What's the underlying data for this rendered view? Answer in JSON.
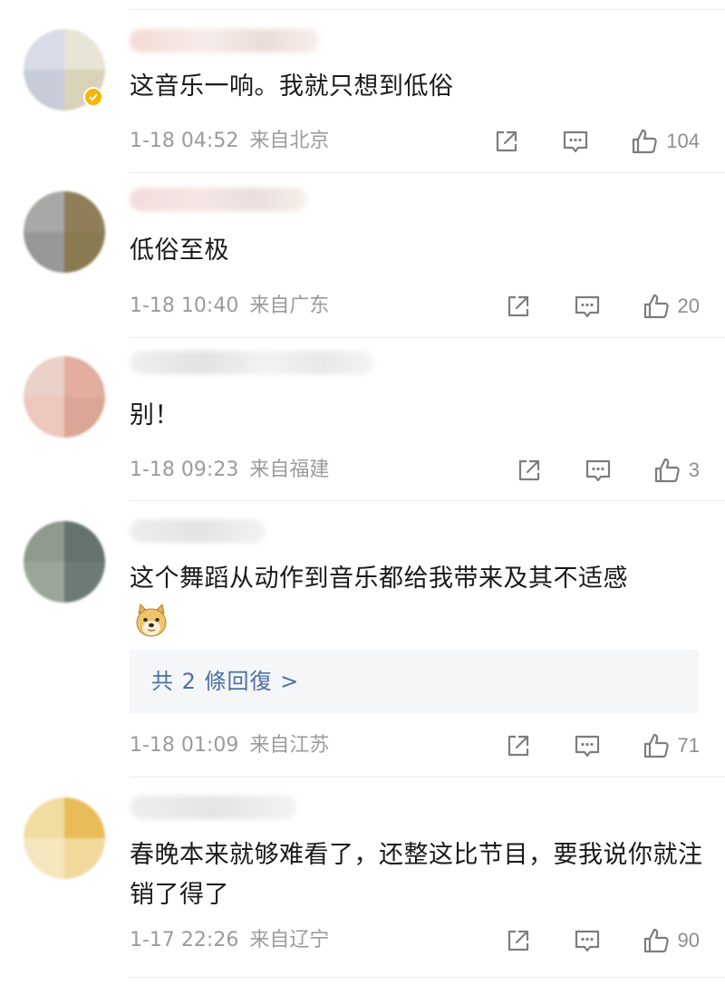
{
  "comments": [
    {
      "text": "这音乐一响。我就只想到低俗",
      "time": "1-18 04:52",
      "location": "来自北京",
      "likes": "104",
      "verified": true,
      "avatar_colors": [
        "#d9dce6",
        "#e8e4d6",
        "#c8ccd8",
        "#d9d2b8"
      ]
    },
    {
      "text": "低俗至极",
      "time": "1-18 10:40",
      "location": "来自广东",
      "likes": "20",
      "avatar_colors": [
        "#a9a8a6",
        "#8f7e58",
        "#9a9896",
        "#8a7a52"
      ]
    },
    {
      "text": "别！",
      "time": "1-18 09:23",
      "location": "来自福建",
      "likes": "3",
      "avatar_colors": [
        "#ead1c8",
        "#e3aea0",
        "#eec7bc",
        "#dba595"
      ]
    },
    {
      "text": "这个舞蹈从动作到音乐都给我带来及其不适感",
      "time": "1-18 01:09",
      "location": "来自江苏",
      "likes": "71",
      "replies": "共 2 條回復 >",
      "avatar_colors": [
        "#8e9a8d",
        "#657370",
        "#9aa69a",
        "#6d7b76"
      ]
    },
    {
      "text": "春晚本来就够难看了，还整这比节目，要我说你就注销了得了",
      "time": "1-17 22:26",
      "location": "来自辽宁",
      "likes": "90",
      "avatar_colors": [
        "#f2dda0",
        "#e9bc5a",
        "#f5e6bd",
        "#f0d99a"
      ]
    }
  ],
  "icons": {
    "share": "share-icon",
    "comment": "comment-icon",
    "like": "thumbs-up-icon",
    "emoji": "doge-emoji-icon"
  },
  "colors": {
    "meta_text": "#9b9b9b",
    "link": "#4c6fa6",
    "verified_badge": "#f7b500",
    "reply_box_bg": "#f5f6f8"
  }
}
